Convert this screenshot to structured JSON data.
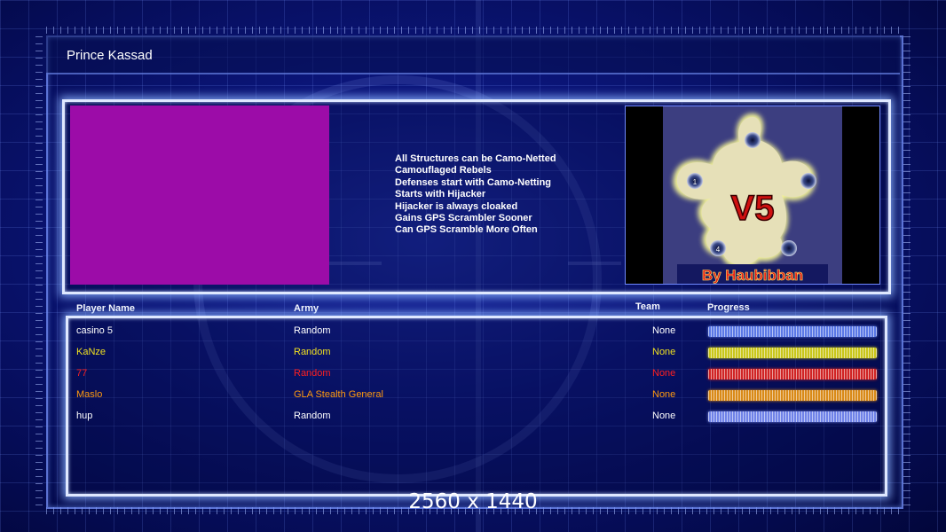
{
  "header": {
    "title": "Prince Kassad"
  },
  "general_info": {
    "color_hex": "#9c0ca8",
    "rules": [
      "All Structures can be Camo-Netted",
      "Camouflaged Rebels",
      "Defenses start with Camo-Netting",
      "Starts with Hijacker",
      "Hijacker is always cloaked",
      "Gains GPS Scrambler Sooner",
      "Can GPS Scramble More Often"
    ]
  },
  "map_preview": {
    "title": "V5",
    "credit": "By Haubibban",
    "start_markers": [
      "1",
      "4"
    ]
  },
  "table": {
    "headers": {
      "player_name": "Player Name",
      "army": "Army",
      "team": "Team",
      "progress": "Progress"
    },
    "rows": [
      {
        "player": "casino 5",
        "army": "Random",
        "team": "None",
        "color": "#ffffff",
        "bar_color": "#5a78e6",
        "progress": 1.0
      },
      {
        "player": "KaNze",
        "army": "Random",
        "team": "None",
        "color": "#f0e020",
        "bar_color": "#c9c61a",
        "progress": 1.0
      },
      {
        "player": "77",
        "army": "Random",
        "team": "None",
        "color": "#ff2020",
        "bar_color": "#d02424",
        "progress": 1.0
      },
      {
        "player": "Maslo",
        "army": "GLA Stealth General",
        "team": "None",
        "color": "#ff9a10",
        "bar_color": "#d98a18",
        "progress": 1.0
      },
      {
        "player": "hup",
        "army": "Random",
        "team": "None",
        "color": "#ffffff",
        "bar_color": "#6f82e8",
        "progress": 1.0
      }
    ]
  },
  "footer": {
    "resolution": "2560 x 1440"
  }
}
